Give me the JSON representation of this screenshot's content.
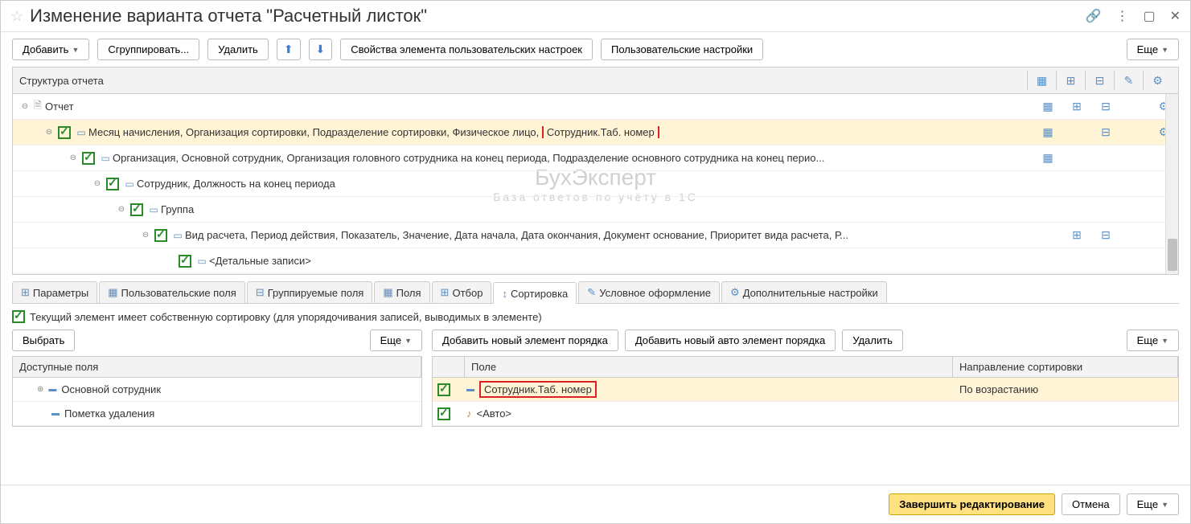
{
  "title": "Изменение варианта отчета \"Расчетный листок\"",
  "toolbar": {
    "add": "Добавить",
    "group": "Сгруппировать...",
    "delete": "Удалить",
    "props": "Свойства элемента пользовательских настроек",
    "user_settings": "Пользовательские настройки",
    "more": "Еще"
  },
  "structure": {
    "header": "Структура отчета",
    "rows": [
      {
        "indent": 0,
        "text": "Отчет"
      },
      {
        "indent": 1,
        "text_a": "Месяц начисления, Организация сортировки, Подразделение сортировки, Физическое лицо,",
        "text_b": "Сотрудник.Таб. номер"
      },
      {
        "indent": 2,
        "text": "Организация, Основной сотрудник, Организация головного сотрудника на конец периода, Подразделение основного сотрудника на конец перио..."
      },
      {
        "indent": 3,
        "text": "Сотрудник, Должность на конец периода"
      },
      {
        "indent": 4,
        "text": "Группа"
      },
      {
        "indent": 5,
        "text": "Вид расчета, Период действия, Показатель, Значение, Дата начала, Дата окончания, Документ основание, Приоритет вида расчета, Р..."
      },
      {
        "indent": 6,
        "text": "<Детальные записи>"
      }
    ]
  },
  "tabs": [
    "Параметры",
    "Пользовательские поля",
    "Группируемые поля",
    "Поля",
    "Отбор",
    "Сортировка",
    "Условное оформление",
    "Дополнительные настройки"
  ],
  "info": "Текущий элемент имеет собственную сортировку (для  упорядочивания записей, выводимых в элементе)",
  "sort_left": {
    "select": "Выбрать",
    "more": "Еще",
    "header": "Доступные поля",
    "rows": [
      "Основной сотрудник",
      "Пометка удаления"
    ]
  },
  "sort_right": {
    "add_new": "Добавить новый элемент порядка",
    "add_auto": "Добавить новый авто элемент порядка",
    "delete": "Удалить",
    "more": "Еще",
    "col_field": "Поле",
    "col_dir": "Направление сортировки",
    "rows": [
      {
        "field": "Сотрудник.Таб. номер",
        "dir": "По возрастанию",
        "highlight": true
      },
      {
        "field": "<Авто>",
        "dir": "",
        "highlight": false
      }
    ]
  },
  "footer": {
    "finish": "Завершить редактирование",
    "cancel": "Отмена",
    "more": "Еще"
  },
  "watermark": {
    "main": "БухЭксперт",
    "sub": "База ответов по учёту в 1С"
  }
}
